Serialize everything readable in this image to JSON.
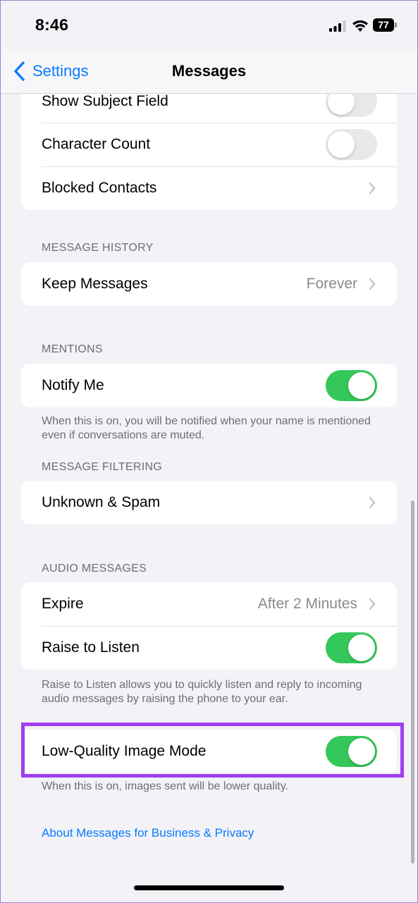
{
  "status_bar": {
    "time": "8:46",
    "battery": "77"
  },
  "nav": {
    "back_label": "Settings",
    "title": "Messages"
  },
  "top_group": {
    "rows": [
      {
        "label": "Show Subject Field",
        "toggle": "off"
      },
      {
        "label": "Character Count",
        "toggle": "off"
      },
      {
        "label": "Blocked Contacts"
      }
    ]
  },
  "message_history": {
    "header": "MESSAGE HISTORY",
    "keep_messages": {
      "label": "Keep Messages",
      "value": "Forever"
    }
  },
  "mentions": {
    "header": "MENTIONS",
    "notify_me": {
      "label": "Notify Me",
      "toggle": "on"
    },
    "footer": "When this is on, you will be notified when your name is mentioned even if conversations are muted."
  },
  "message_filtering": {
    "header": "MESSAGE FILTERING",
    "unknown_spam": {
      "label": "Unknown & Spam"
    }
  },
  "audio_messages": {
    "header": "AUDIO MESSAGES",
    "expire": {
      "label": "Expire",
      "value": "After 2 Minutes"
    },
    "raise_to_listen": {
      "label": "Raise to Listen",
      "toggle": "on"
    },
    "footer": "Raise to Listen allows you to quickly listen and reply to incoming audio messages by raising the phone to your ear."
  },
  "low_quality": {
    "label": "Low-Quality Image Mode",
    "toggle": "on",
    "footer": "When this is on, images sent will be lower quality."
  },
  "about_link": "About Messages for Business & Privacy",
  "colors": {
    "accent": "#0a7aff",
    "toggle_on": "#34c759",
    "highlight": "#a03ef0"
  }
}
